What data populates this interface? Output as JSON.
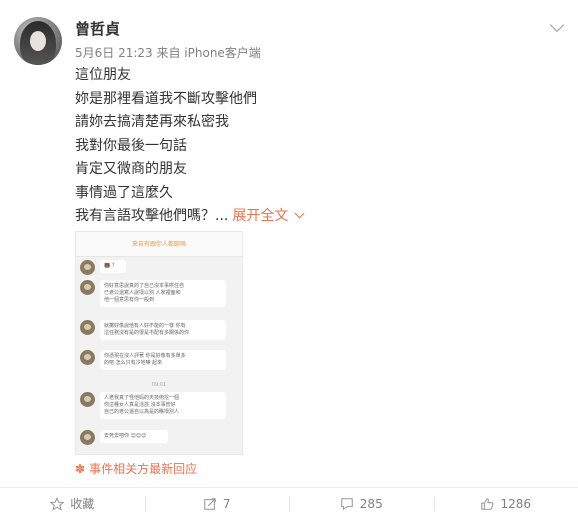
{
  "post": {
    "author": "曾哲貞",
    "meta": "5月6日 21:23 来自 iPhone客户端",
    "lines": [
      "這位朋友",
      "妳是那裡看道我不斷攻擊他們",
      "請妳去搞清楚再來私密我",
      "我對你最後一句話",
      "肯定又微商的朋友",
      "事情過了這麼久",
      "我有言語攻擊他們嗎？..."
    ],
    "expand_label": "展开全文",
    "event_link": "事件相关方最新回应"
  },
  "screenshot": {
    "header": "來自有跟你人都聊嗎",
    "messages": [
      "🐻 ?",
      "你好意思說真的了自己沒本事哄住自\n已老公還寫人說壞以別 人家裡面和\n他一個意思有你一般到",
      "就攤好像說他有人好不能的一樣 你有\n這任務沒有是的很是不配有多關係的你",
      "你憑現在沒人評著 你是好像有多單多\n的吧 怎么只有冷地嘛 起來",
      "人老我真了怪他妈的天技術挖一個\n你這種女人真是活該 沒本事管好\n自己的老公還自以為是的瞧壞別人",
      "去死去吧你 😊😊😊"
    ],
    "time_label": "09:01"
  },
  "actions": [
    {
      "icon": "star-icon",
      "label": "收藏"
    },
    {
      "icon": "share-icon",
      "label": "7"
    },
    {
      "icon": "comment-icon",
      "label": "285"
    },
    {
      "icon": "thumbs-up-icon",
      "label": "1286"
    }
  ],
  "colors": {
    "accent": "#eb7350",
    "muted": "#808080"
  }
}
